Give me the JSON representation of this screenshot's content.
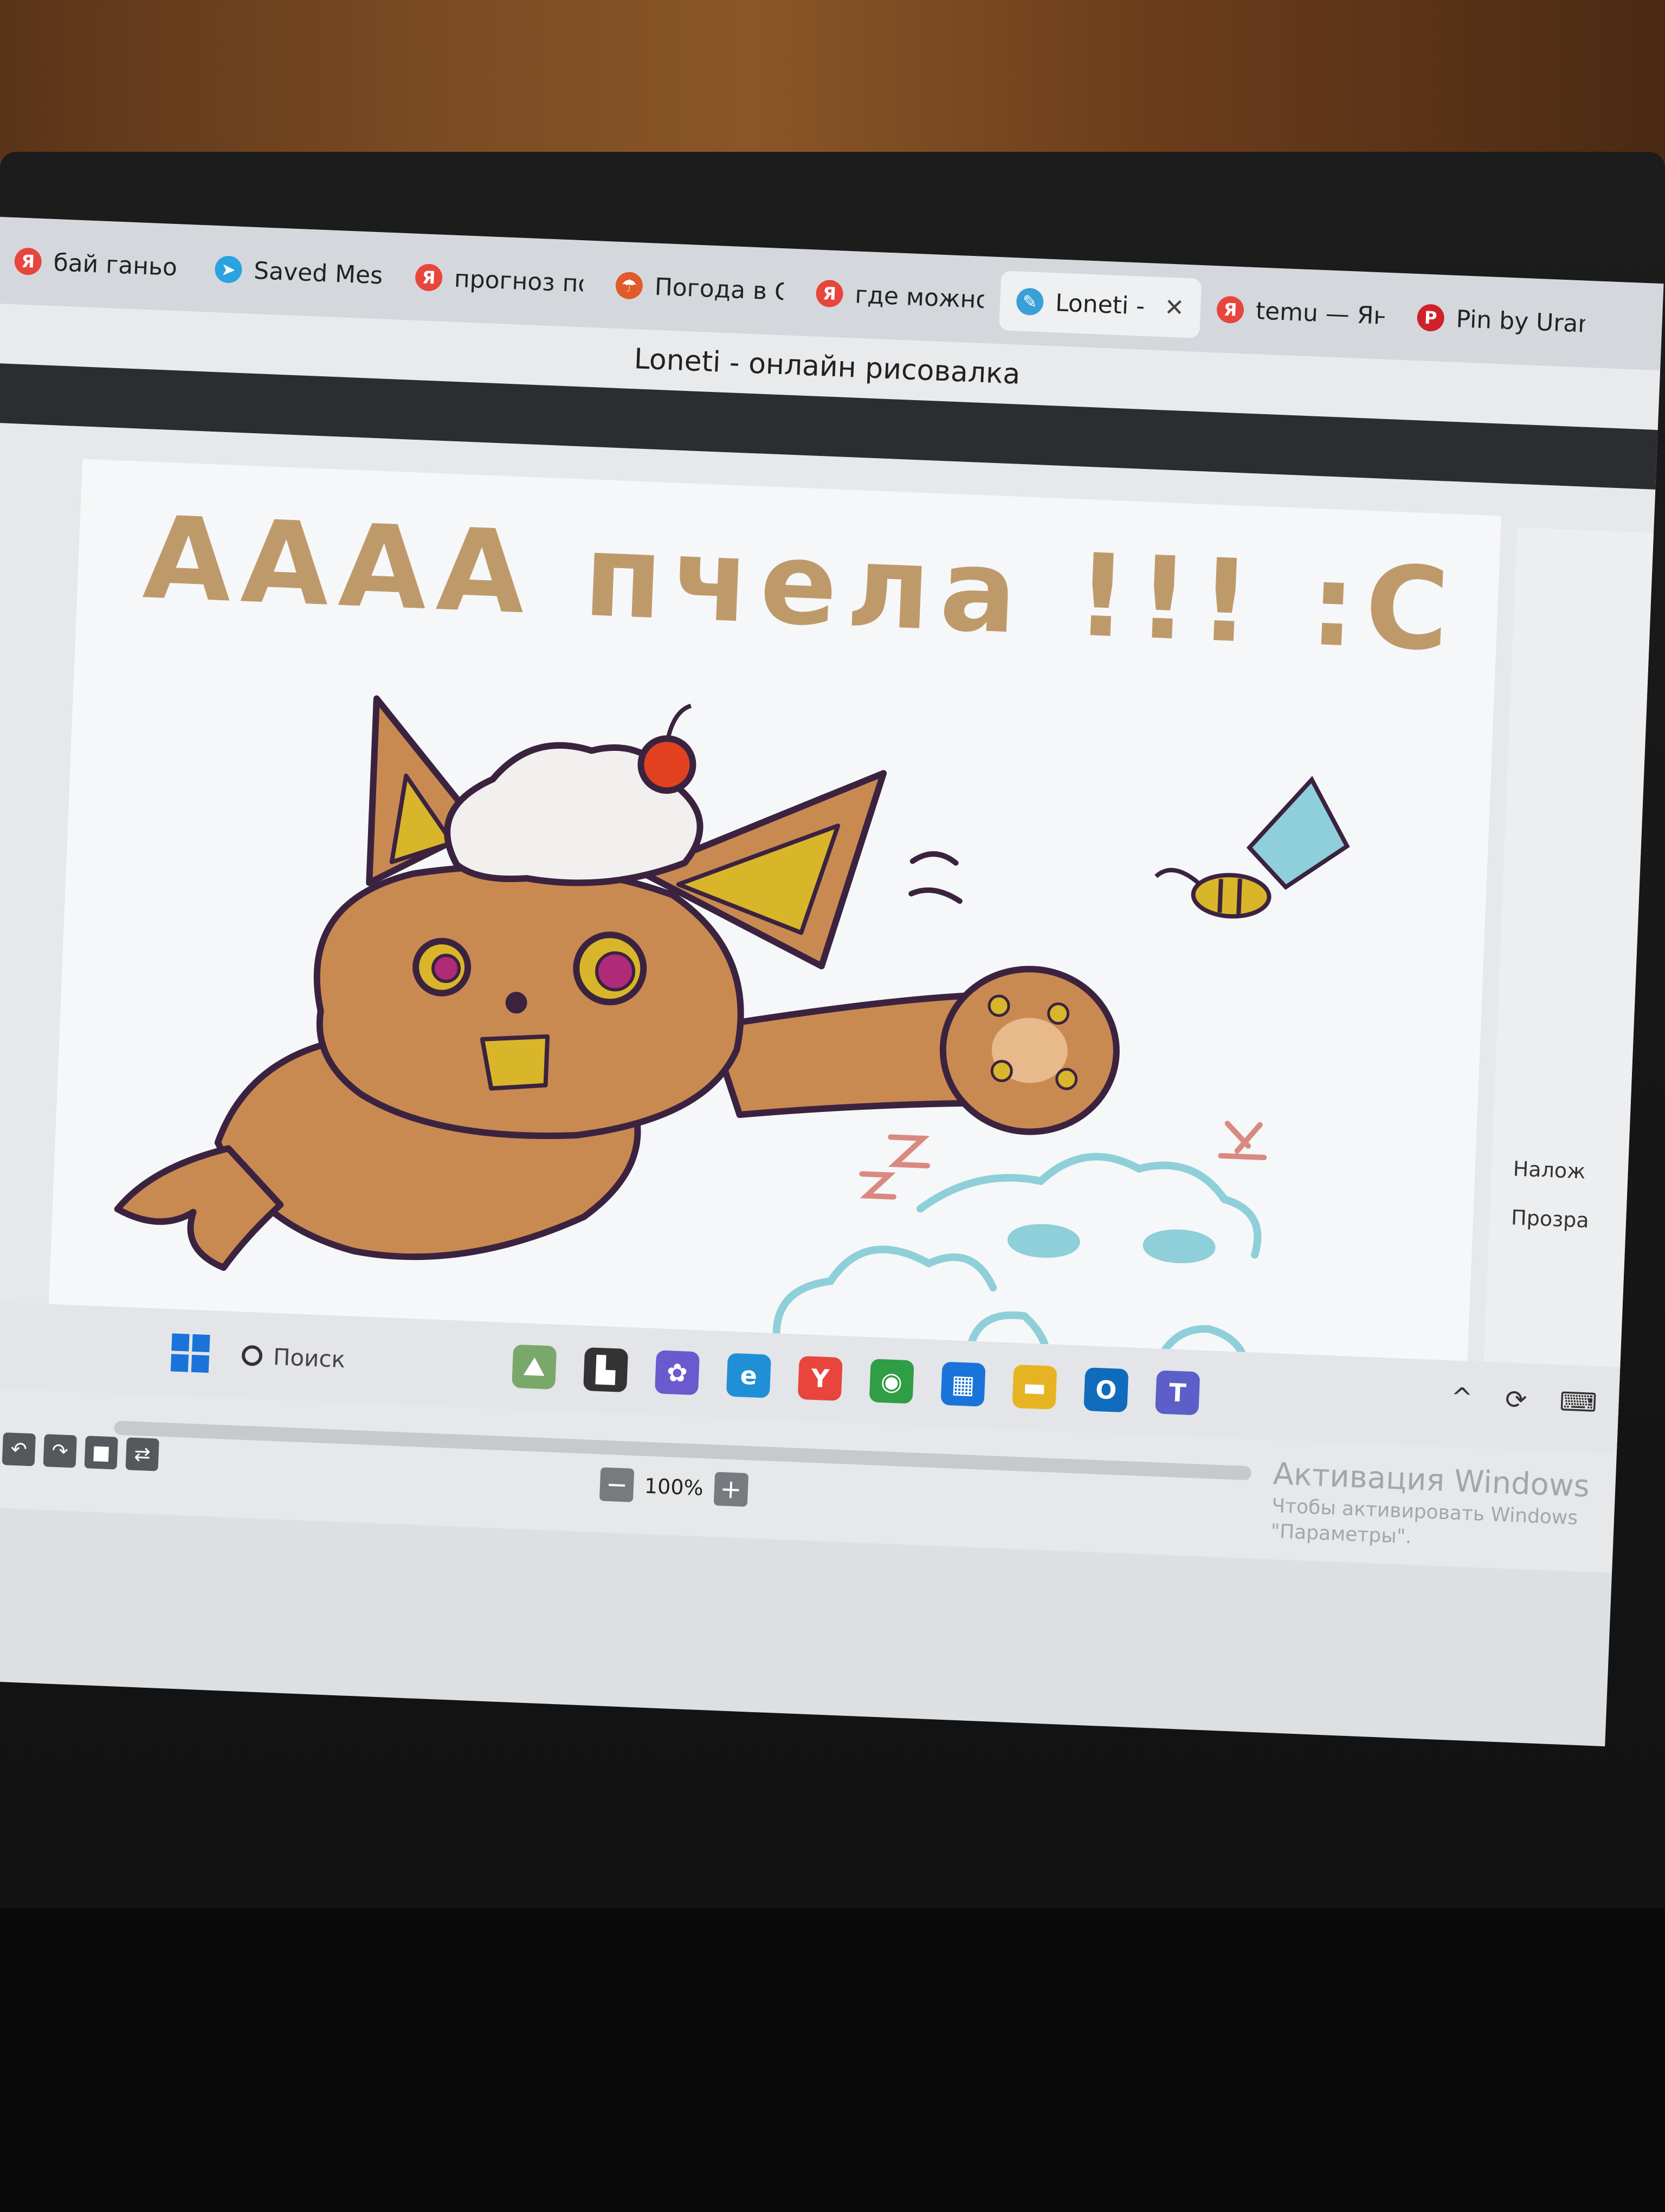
{
  "browser": {
    "tabs": [
      {
        "label": "бай ганьо -",
        "icon": "yandex-icon",
        "color": "#e8453c",
        "glyph": "Я"
      },
      {
        "label": "Saved Mess",
        "icon": "telegram-icon",
        "color": "#2aa3de",
        "glyph": "➤"
      },
      {
        "label": "прогноз по",
        "icon": "yandex-icon",
        "color": "#e8453c",
        "glyph": "Я"
      },
      {
        "label": "Погода в С",
        "icon": "umbrella-icon",
        "color": "#e05a2a",
        "glyph": "☂"
      },
      {
        "label": "где можно",
        "icon": "yandex-icon",
        "color": "#e8453c",
        "glyph": "Я"
      },
      {
        "label": "Loneti - о",
        "icon": "pen-icon",
        "color": "#3aa0d8",
        "glyph": "✎",
        "active": true
      },
      {
        "label": "temu — Янд",
        "icon": "yandex-icon",
        "color": "#e8453c",
        "glyph": "Я"
      },
      {
        "label": "Pin by Uran",
        "icon": "pinterest-icon",
        "color": "#d0212a",
        "glyph": "P"
      }
    ],
    "close_glyph": "✕",
    "window_title": "Loneti - онлайн рисовалка"
  },
  "drawing": {
    "caption": "АААА пчела !!! :С",
    "colors": {
      "fur": "#c98a52",
      "fur_light": "#e8b98a",
      "outline": "#3b2340",
      "ear_inner": "#d9b52a",
      "cream": "#f2f0ee",
      "cherry": "#e2411f",
      "bee_wing": "#8fcfdc",
      "bee_body": "#d9b52a",
      "text": "#b8905c",
      "doodle": "#8ecfd9"
    }
  },
  "side_panel": {
    "label_1": "Налож",
    "label_2": "Прозра"
  },
  "zoom": {
    "minus": "−",
    "value": "100%",
    "plus": "+"
  },
  "tools": [
    "⟩",
    "↶",
    "↷",
    "■",
    "⇄"
  ],
  "watermark": {
    "line1": "Активация Windows",
    "line2": "Чтобы активировать Windows",
    "line3": "\"Параметры\"."
  },
  "taskbar": {
    "search_placeholder": "Поиск",
    "apps": [
      {
        "name": "widgets-icon",
        "color": "#7aa86b",
        "glyph": "⛰"
      },
      {
        "name": "task-view-icon",
        "color": "#333333",
        "glyph": "▙"
      },
      {
        "name": "copilot-icon",
        "color": "#6a5acd",
        "glyph": "✿"
      },
      {
        "name": "edge-icon",
        "color": "#1f8fd6",
        "glyph": "e"
      },
      {
        "name": "yandex-browser-icon",
        "color": "#e8453c",
        "glyph": "Y"
      },
      {
        "name": "chrome-icon",
        "color": "#2f9e44",
        "glyph": "◉"
      },
      {
        "name": "store-icon",
        "color": "#1a73d9",
        "glyph": "▦"
      },
      {
        "name": "explorer-icon",
        "color": "#e6b422",
        "glyph": "▬"
      },
      {
        "name": "outlook-icon",
        "color": "#0f6cbd",
        "glyph": "O"
      },
      {
        "name": "teams-icon",
        "color": "#5b5fc7",
        "glyph": "T"
      }
    ],
    "tray": [
      "^",
      "⟳",
      "⌨"
    ]
  }
}
